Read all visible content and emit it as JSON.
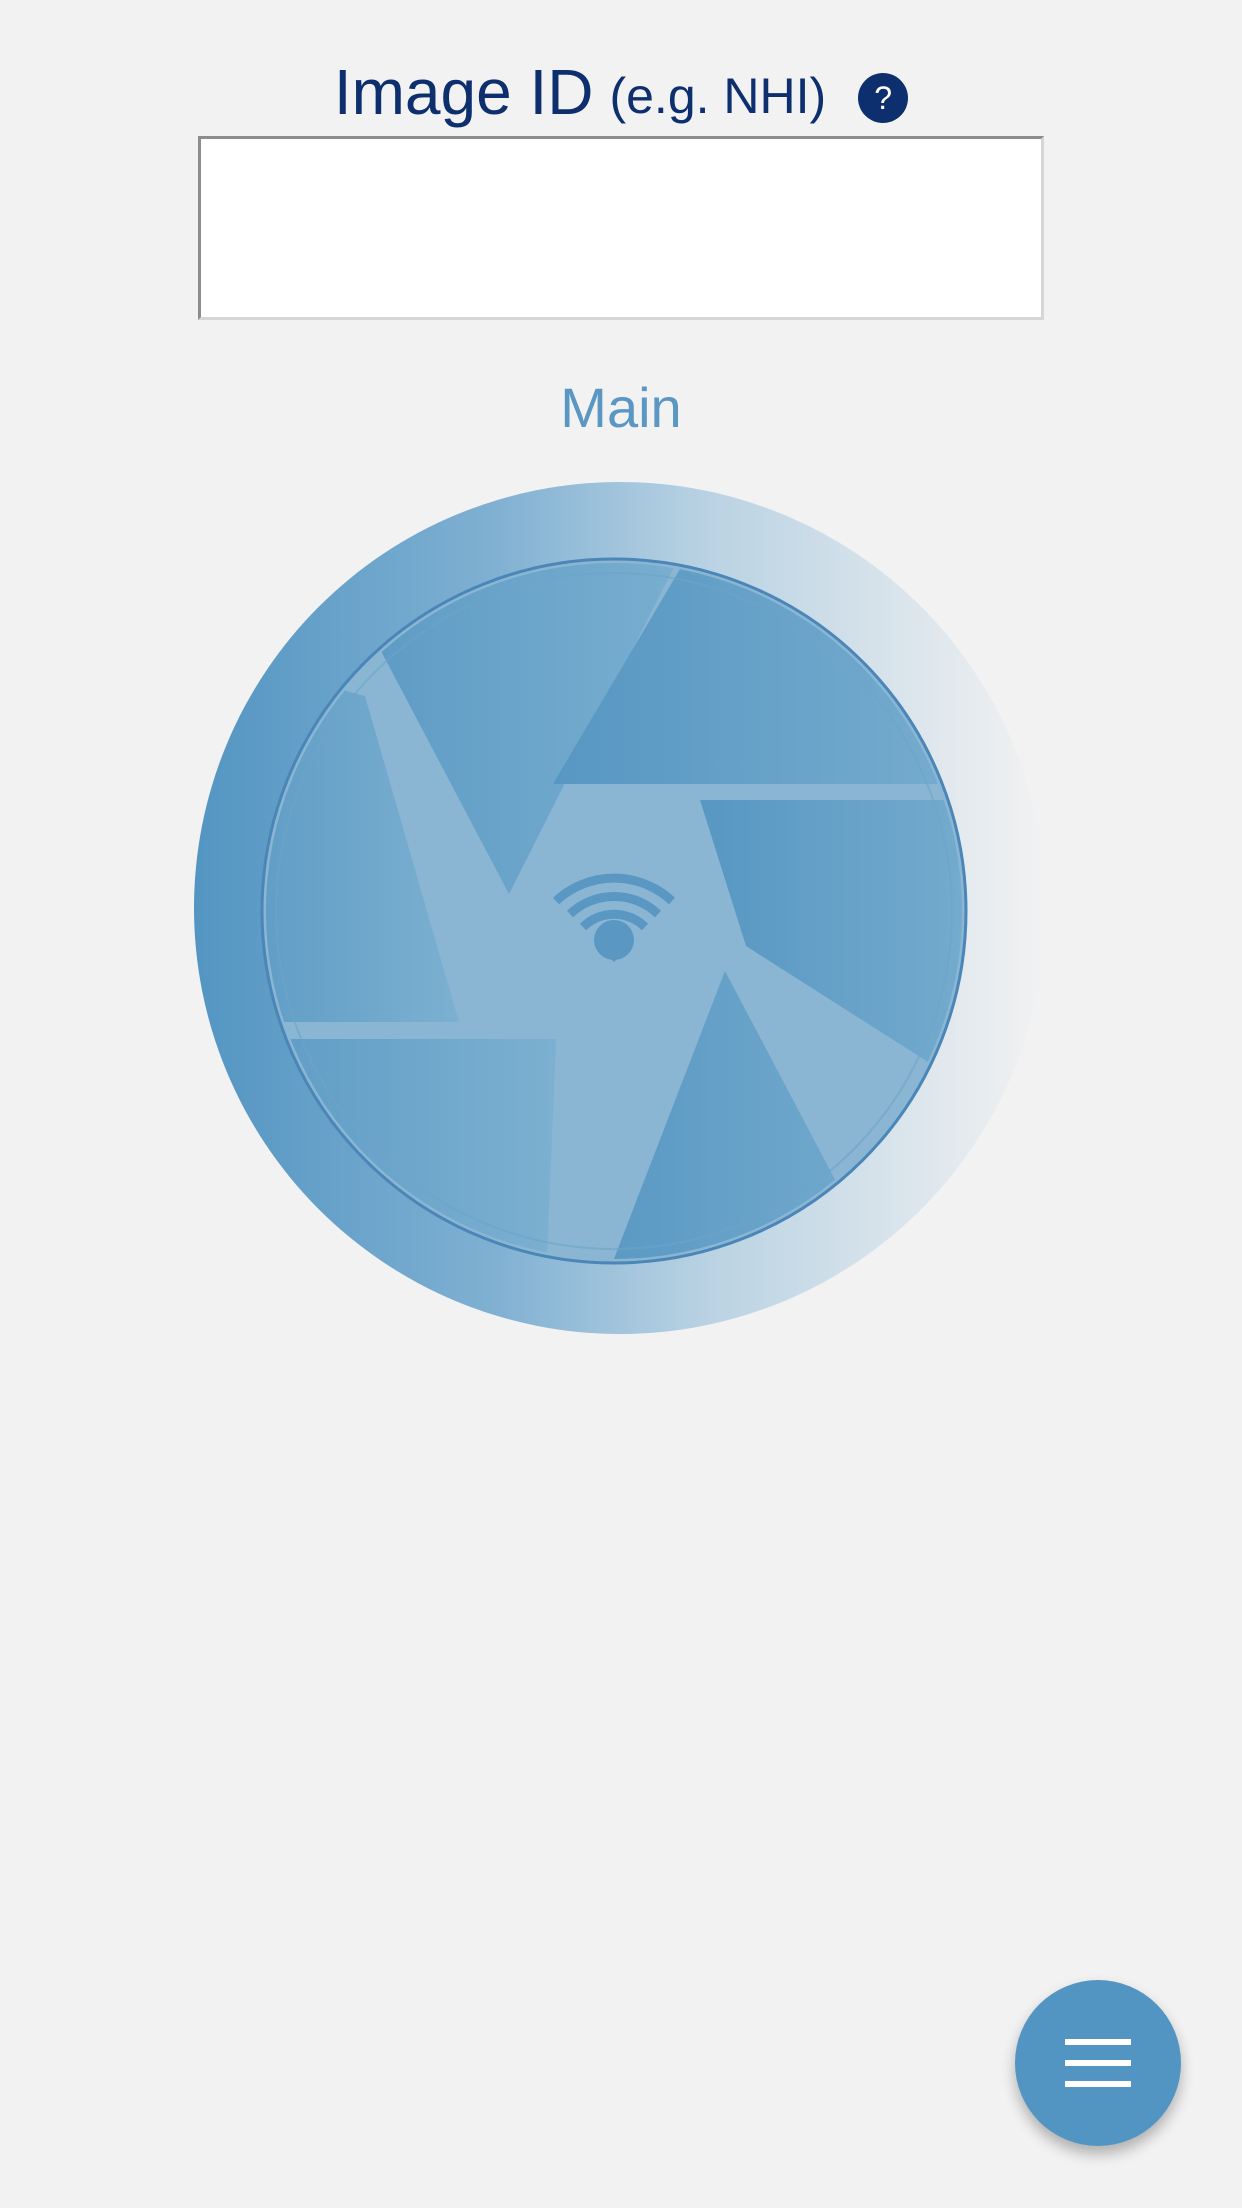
{
  "header": {
    "title": "Image ID",
    "subtitle": "(e.g. NHI)",
    "help_symbol": "?"
  },
  "id_field": {
    "value": "",
    "placeholder": ""
  },
  "mode": {
    "label": "Main"
  },
  "capture_button": {
    "icon": "camera-shutter-icon",
    "status_icon": "wifi-icon"
  },
  "menu_button": {
    "icon": "hamburger-menu-icon"
  },
  "colors": {
    "navy": "#0d2f6e",
    "accent_blue": "#5395c2",
    "label_blue": "#5a97c3",
    "background": "#f2f2f2"
  }
}
